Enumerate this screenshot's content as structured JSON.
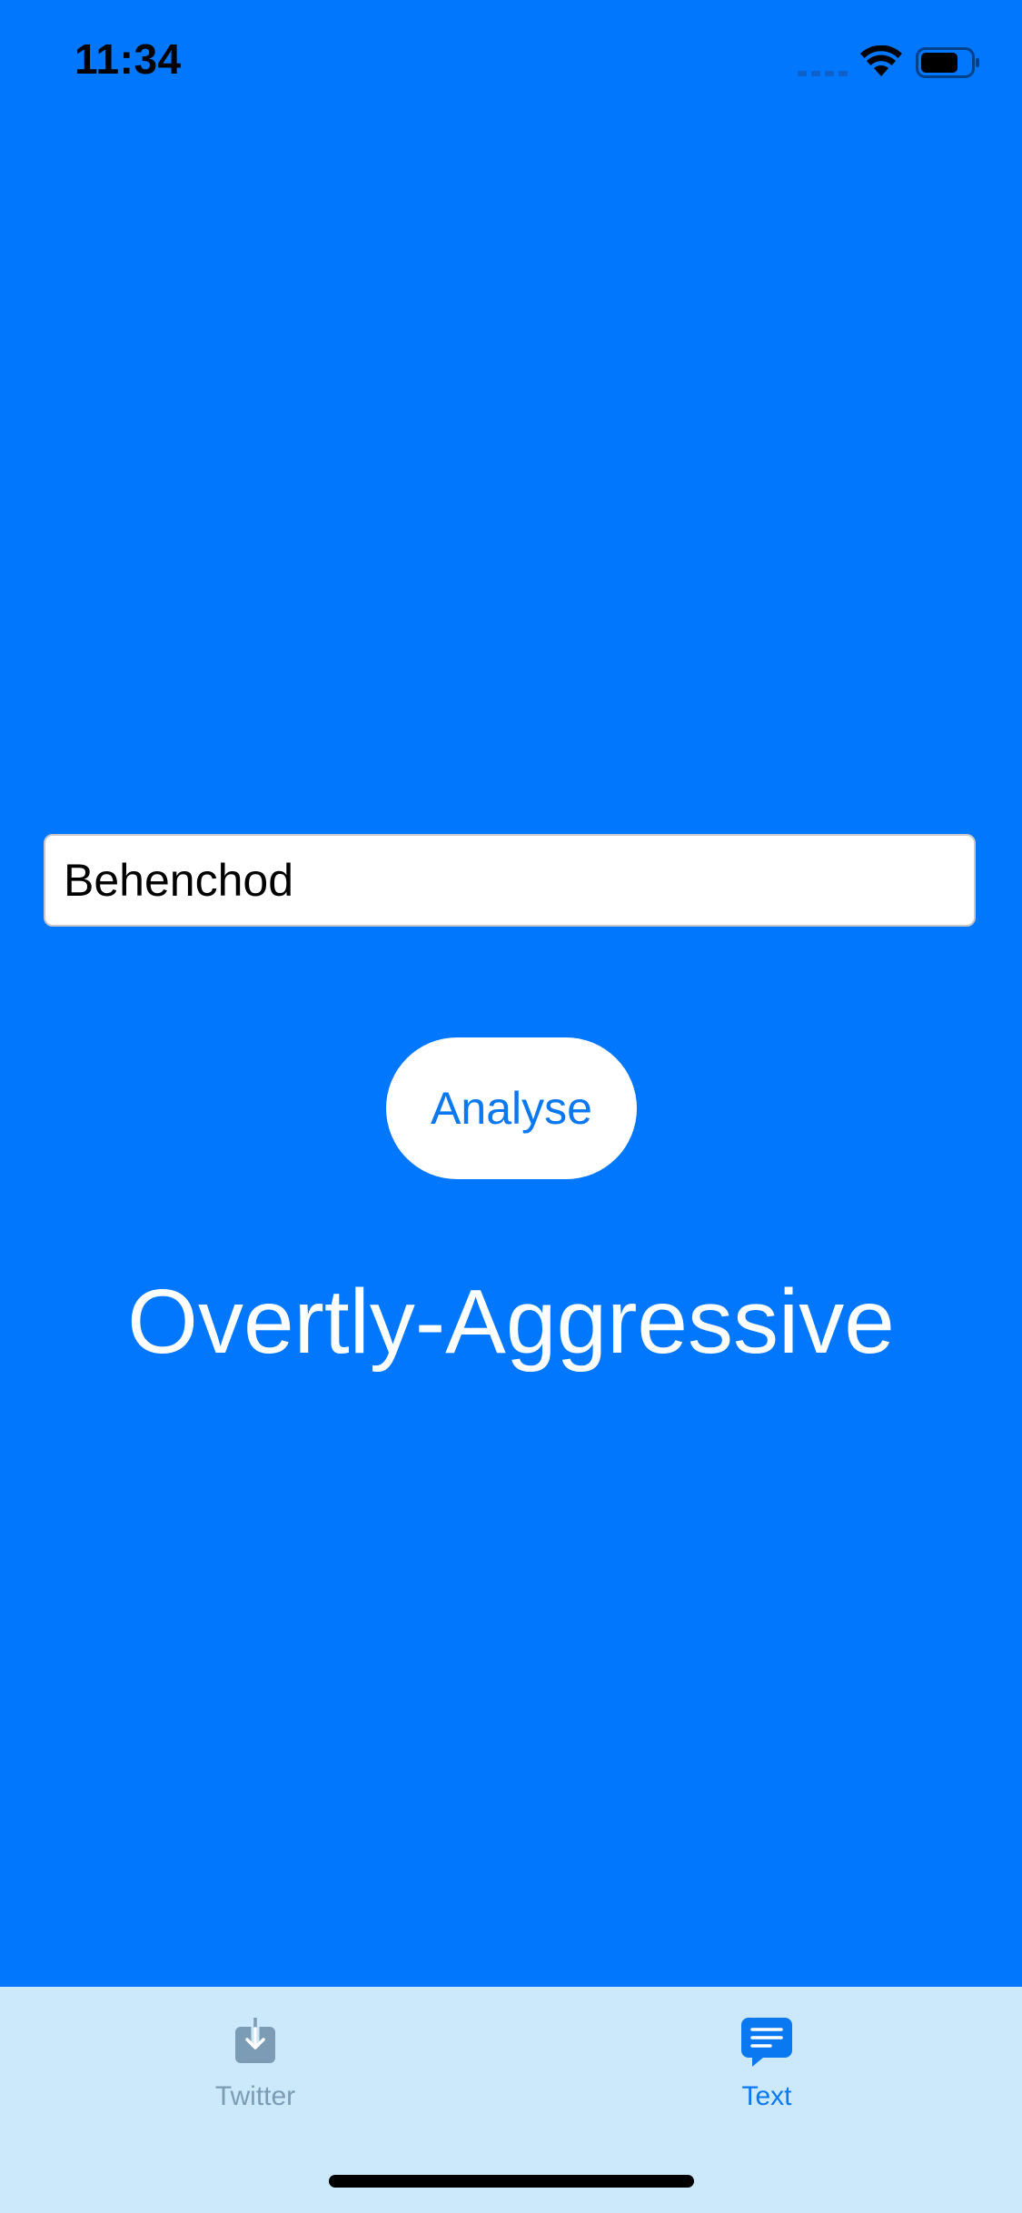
{
  "status_bar": {
    "time": "11:34"
  },
  "input": {
    "value": "Behenchod"
  },
  "analyse_button": {
    "label": "Analyse"
  },
  "result": {
    "text": "Overtly-Aggressive"
  },
  "tab_bar": {
    "tabs": [
      {
        "label": "Twitter",
        "icon": "inbox-download-icon",
        "selected": false
      },
      {
        "label": "Text",
        "icon": "message-bubble-icon",
        "selected": true
      }
    ]
  },
  "colors": {
    "background": "#0077fd",
    "tab_bar": "#cce8fb",
    "accent": "#0a78f0",
    "inactive_tab": "#7b9cb4"
  }
}
